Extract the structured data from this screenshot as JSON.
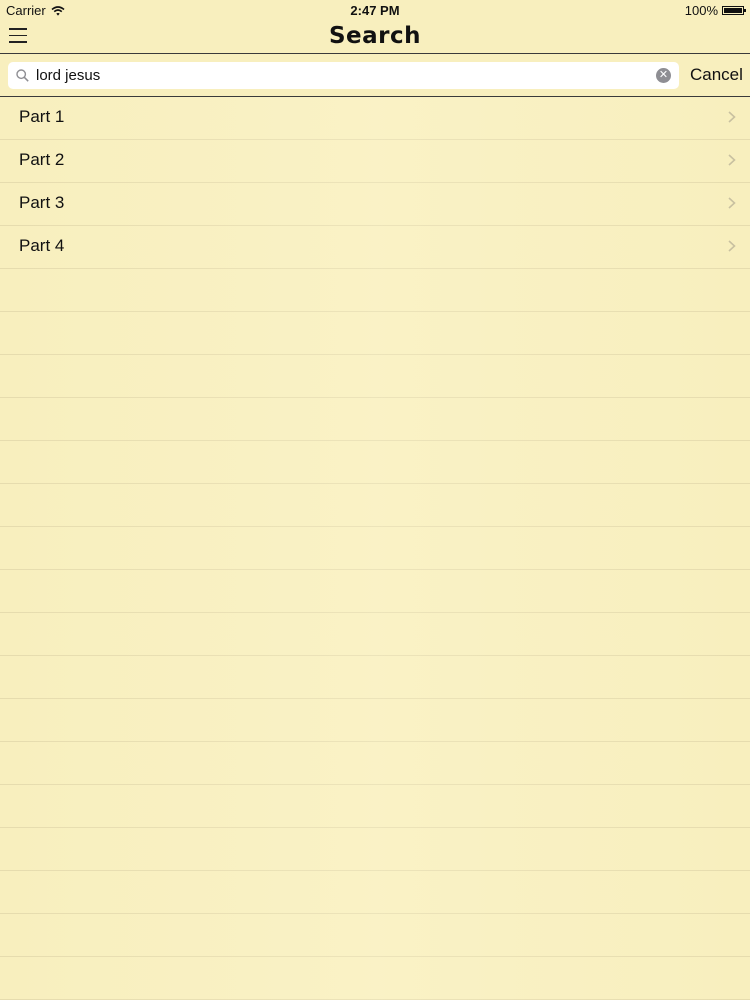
{
  "status_bar": {
    "carrier": "Carrier",
    "time": "2:47 PM",
    "battery": "100%"
  },
  "nav": {
    "title": "Search"
  },
  "search": {
    "value": "lord jesus",
    "cancel_label": "Cancel"
  },
  "results": [
    {
      "label": "Part 1"
    },
    {
      "label": "Part 2"
    },
    {
      "label": "Part 3"
    },
    {
      "label": "Part 4"
    }
  ],
  "colors": {
    "background": "#f8efbe",
    "rule_line": "#e6dcae"
  }
}
